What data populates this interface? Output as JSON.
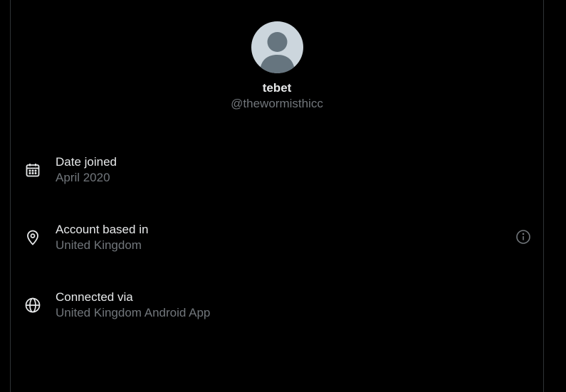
{
  "profile": {
    "display_name": "tebet",
    "handle": "@thewormisthicc"
  },
  "about": {
    "date_joined": {
      "label": "Date joined",
      "value": "April 2020",
      "icon": "calendar-icon"
    },
    "account_based_in": {
      "label": "Account based in",
      "value": "United Kingdom",
      "icon": "location-pin-icon",
      "info_icon": "info-icon"
    },
    "connected_via": {
      "label": "Connected via",
      "value": "United Kingdom Android App",
      "icon": "globe-icon"
    }
  },
  "colors": {
    "background": "#000000",
    "primary_text": "#e7e9ea",
    "secondary_text": "#71767b",
    "avatar_bg": "#ccd6dd",
    "avatar_figure": "#66757f"
  }
}
